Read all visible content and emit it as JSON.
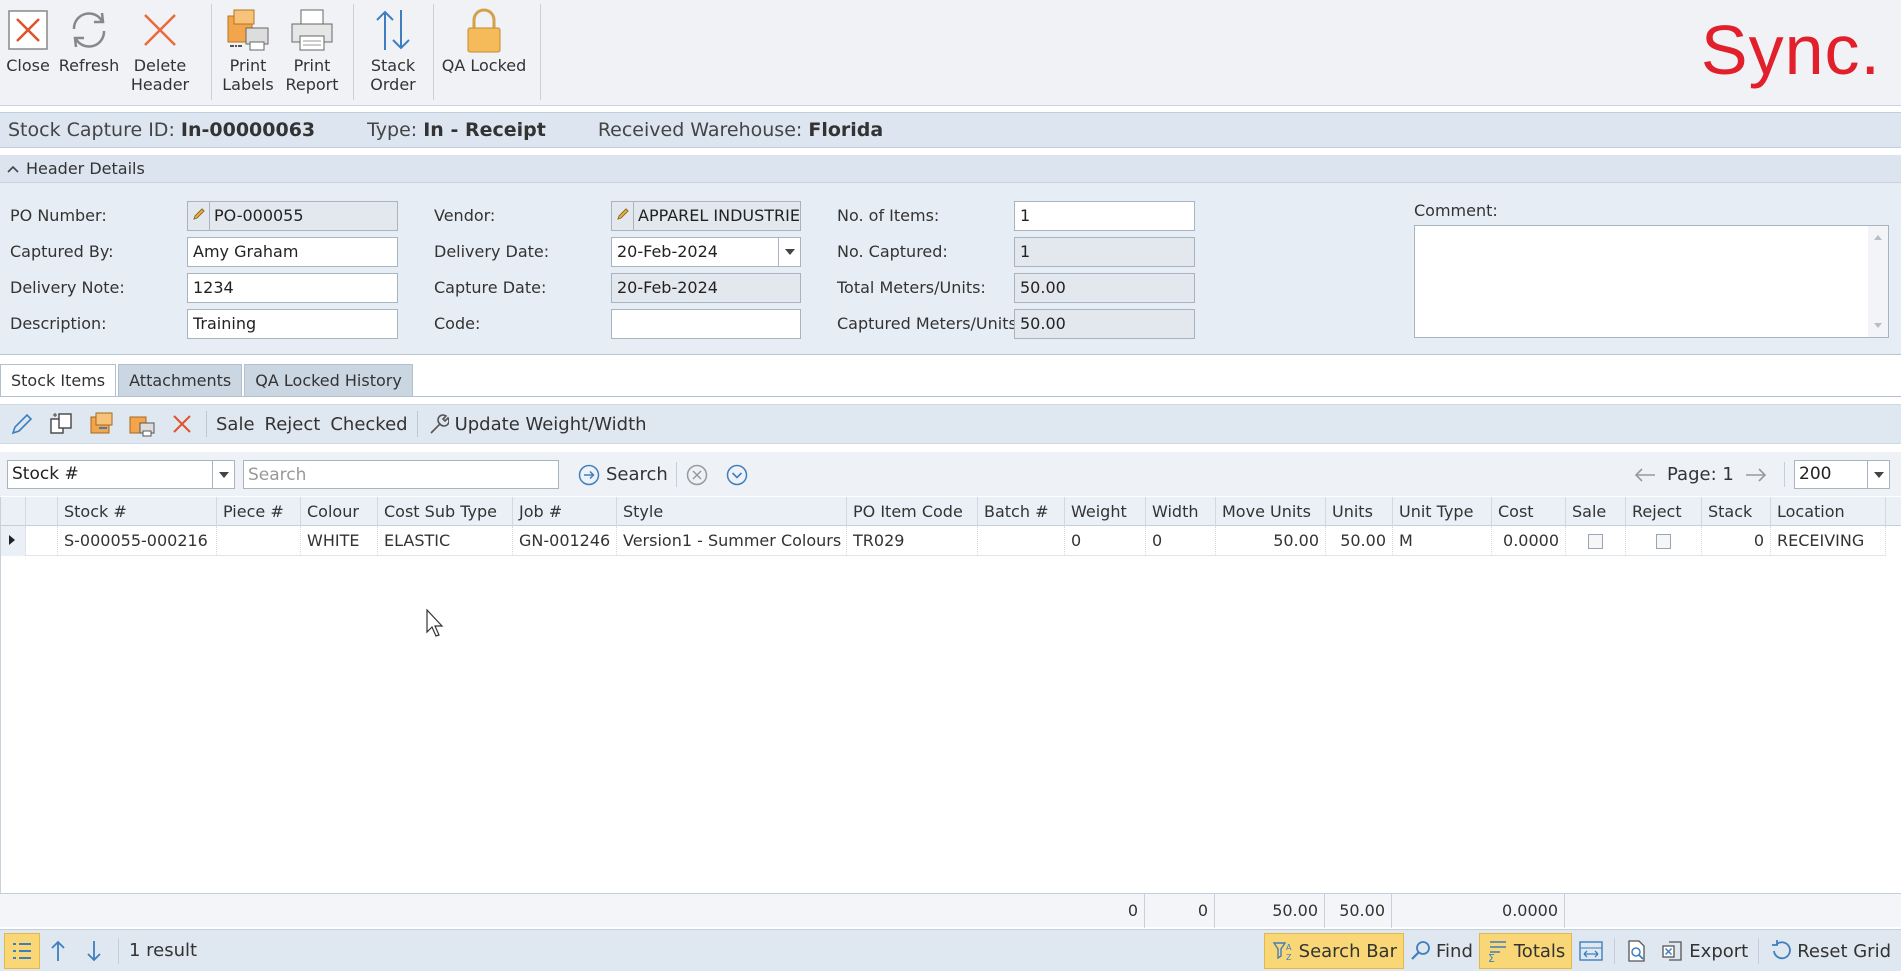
{
  "ribbon": {
    "close": "Close",
    "refresh": "Refresh",
    "delete_header": [
      "Delete",
      "Header"
    ],
    "print_labels": [
      "Print",
      "Labels"
    ],
    "print_report": [
      "Print",
      "Report"
    ],
    "stack_order": [
      "Stack",
      "Order"
    ],
    "qa_locked": "QA Locked",
    "brand": "Sync."
  },
  "info": {
    "id_label": "Stock Capture ID:",
    "id_value": "In-00000063",
    "type_label": "Type:",
    "type_value": "In - Receipt",
    "wh_label": "Received Warehouse:",
    "wh_value": "Florida"
  },
  "header_details": {
    "title": "Header Details",
    "po_number_label": "PO Number:",
    "po_number": "PO-000055",
    "captured_by_label": "Captured By:",
    "captured_by": "Amy Graham",
    "delivery_note_label": "Delivery Note:",
    "delivery_note": "1234",
    "description_label": "Description:",
    "description": "Training",
    "vendor_label": "Vendor:",
    "vendor": "APPAREL INDUSTRIE",
    "delivery_date_label": "Delivery Date:",
    "delivery_date": "20-Feb-2024",
    "capture_date_label": "Capture Date:",
    "capture_date": "20-Feb-2024",
    "code_label": "Code:",
    "code": "",
    "no_items_label": "No. of Items:",
    "no_items": "1",
    "no_captured_label": "No. Captured:",
    "no_captured": "1",
    "total_units_label": "Total Meters/Units:",
    "total_units": "50.00",
    "captured_units_label": "Captured Meters/Units:",
    "captured_units": "50.00",
    "comment_label": "Comment:",
    "comment": ""
  },
  "tabs": [
    "Stock Items",
    "Attachments",
    "QA Locked History"
  ],
  "toolbar": {
    "sale": "Sale",
    "reject": "Reject",
    "checked": "Checked",
    "update_weight": "Update Weight/Width"
  },
  "search": {
    "field": "Stock #",
    "placeholder": "Search",
    "button": "Search",
    "page": "Page: 1",
    "page_size": "200"
  },
  "grid": {
    "columns": [
      "Stock #",
      "Piece #",
      "Colour",
      "Cost Sub Type",
      "Job #",
      "Style",
      "PO Item Code",
      "Batch #",
      "Weight",
      "Width",
      "Move Units",
      "Units",
      "Unit Type",
      "Cost",
      "Sale",
      "Reject",
      "Stack",
      "Location"
    ],
    "rows": [
      {
        "stock": "S-000055-000216",
        "piece": "",
        "colour": "WHITE",
        "cost_sub_type": "ELASTIC",
        "job": "GN-001246",
        "style": "Version1 - Summer Colours",
        "po_item_code": "TR029",
        "batch": "",
        "weight": "0",
        "width": "0",
        "move_units": "50.00",
        "units": "50.00",
        "unit_type": "M",
        "cost": "0.0000",
        "stack": "0",
        "location": "RECEIVING"
      }
    ],
    "totals": {
      "weight": "0",
      "width": "0",
      "move_units": "50.00",
      "units": "50.00",
      "cost": "0.0000"
    }
  },
  "status": {
    "result": "1 result",
    "search_bar": "Search Bar",
    "find": "Find",
    "totals": "Totals",
    "export": "Export",
    "reset_grid": "Reset Grid"
  }
}
